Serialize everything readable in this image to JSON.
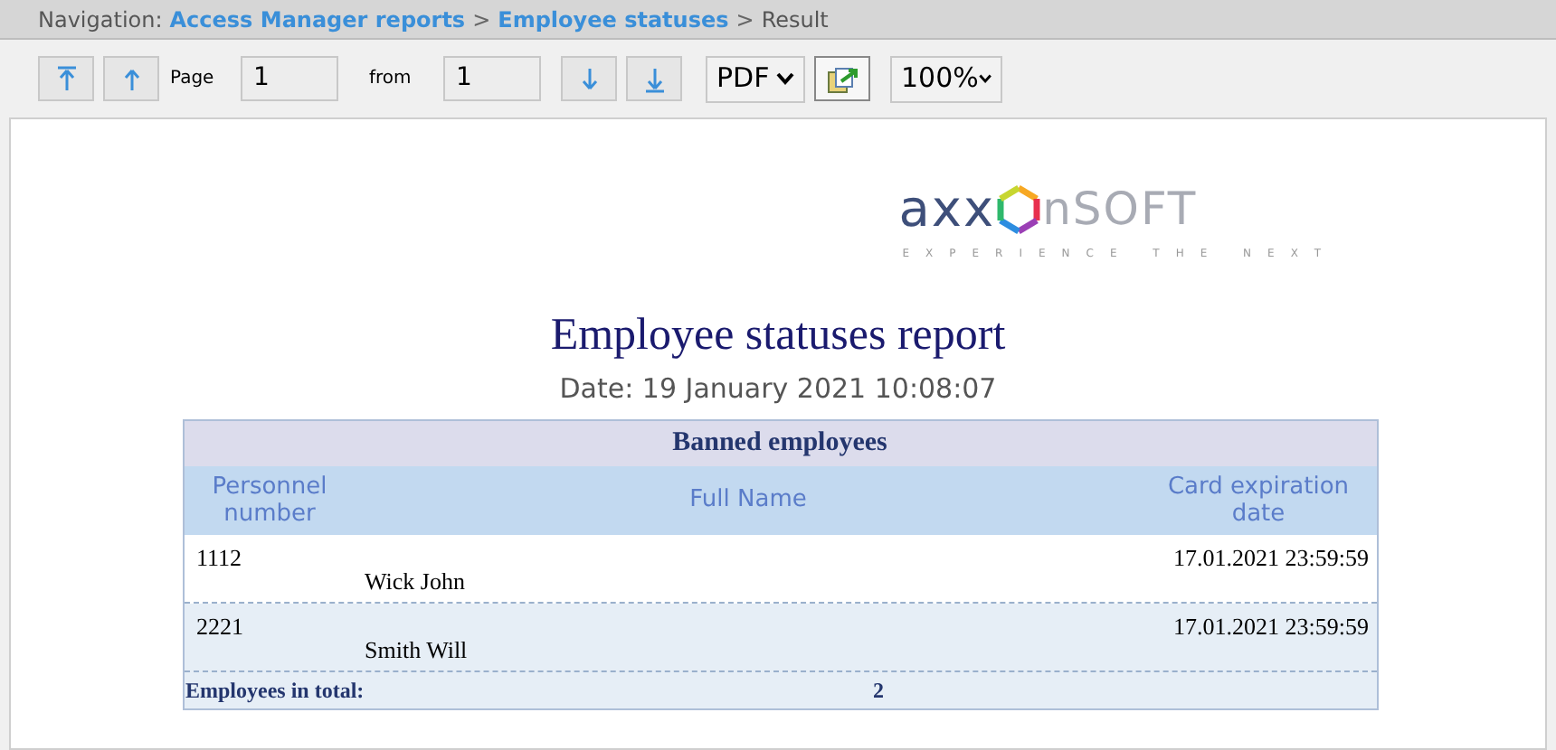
{
  "navigation": {
    "label": "Navigation:",
    "separator": ">",
    "crumbs": [
      {
        "text": "Access Manager reports",
        "kind": "link"
      },
      {
        "text": "Employee statuses",
        "kind": "link"
      },
      {
        "text": "Result",
        "kind": "current"
      }
    ]
  },
  "toolbar": {
    "page_label": "Page",
    "page_value": "1",
    "from_label": "from",
    "from_value": "1",
    "format": "PDF",
    "zoom": "100%"
  },
  "logo": {
    "left": "axx",
    "right": "nSOFT",
    "tagline": "EXPERIENCE THE NEXT"
  },
  "report": {
    "title": "Employee statuses report",
    "date": "Date: 19 January 2021 10:08:07",
    "table": {
      "caption": "Banned employees",
      "columns": [
        "Personnel number",
        "Full Name",
        "Card expiration date"
      ],
      "rows": [
        {
          "number": "1112",
          "name": "Wick John",
          "expiration": "17.01.2021 23:59:59"
        },
        {
          "number": "2221",
          "name": "Smith Will",
          "expiration": "17.01.2021 23:59:59"
        }
      ],
      "total_label": "Employees in total:",
      "total_value": "2"
    }
  }
}
